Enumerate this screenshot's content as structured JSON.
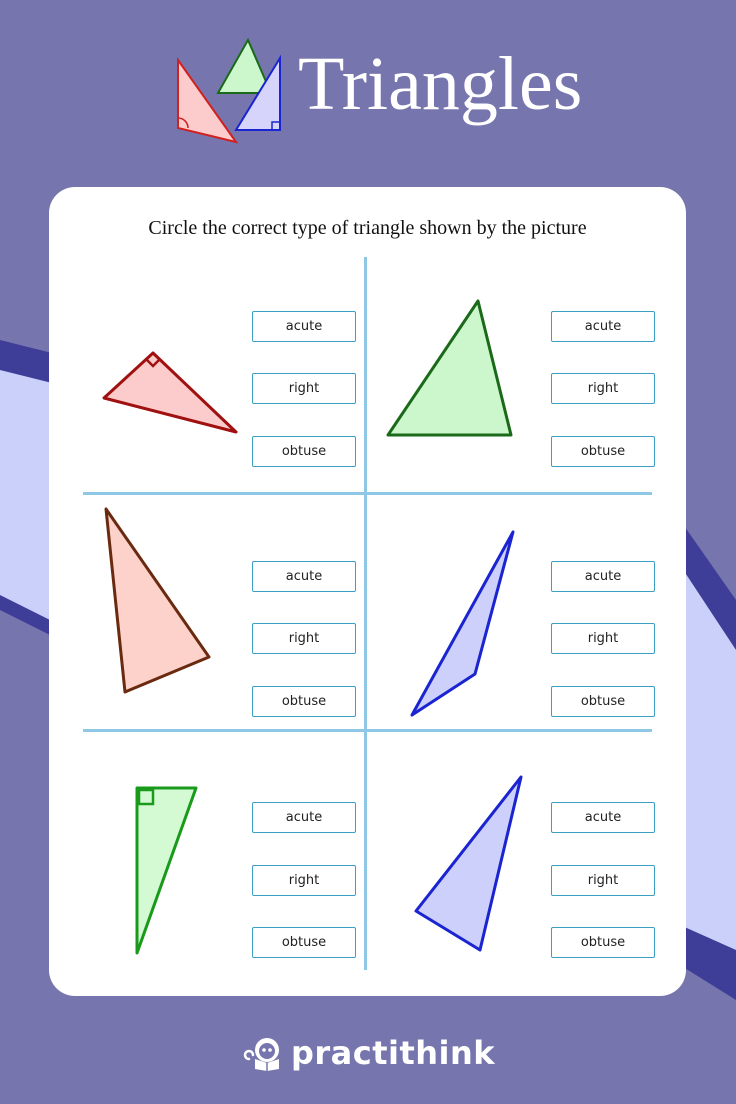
{
  "colors": {
    "background": "#7775ae",
    "stripe_dark": "#3e3d98",
    "stripe_light": "#cbd0fa",
    "card": "#ffffff",
    "divider": "#8fc8e6",
    "option_border": "#3a9fc3"
  },
  "header": {
    "title": "Triangles",
    "logo_icon": "triangles-icon"
  },
  "worksheet": {
    "instruction": "Circle the correct type of triangle shown by the picture",
    "questions": [
      {
        "id": 1,
        "triangle": "red right triangle",
        "stroke": "#a01010",
        "fill": "#fccccc",
        "options": [
          "acute",
          "right",
          "obtuse"
        ]
      },
      {
        "id": 2,
        "triangle": "green acute triangle",
        "stroke": "#1a6a1a",
        "fill": "#ccf7cc",
        "options": [
          "acute",
          "right",
          "obtuse"
        ]
      },
      {
        "id": 3,
        "triangle": "brown acute triangle",
        "stroke": "#6a2a10",
        "fill": "#fcd2ca",
        "options": [
          "acute",
          "right",
          "obtuse"
        ]
      },
      {
        "id": 4,
        "triangle": "blue obtuse triangle",
        "stroke": "#1a24d0",
        "fill": "#ccd0fa",
        "options": [
          "acute",
          "right",
          "obtuse"
        ]
      },
      {
        "id": 5,
        "triangle": "green right triangle",
        "stroke": "#1a9a1a",
        "fill": "#d4fad4",
        "options": [
          "acute",
          "right",
          "obtuse"
        ]
      },
      {
        "id": 6,
        "triangle": "blue acute triangle",
        "stroke": "#1a24d0",
        "fill": "#ccd0fa",
        "options": [
          "acute",
          "right",
          "obtuse"
        ]
      }
    ]
  },
  "footer": {
    "brand": "practithink",
    "brand_icon": "monkey-reading-icon"
  }
}
